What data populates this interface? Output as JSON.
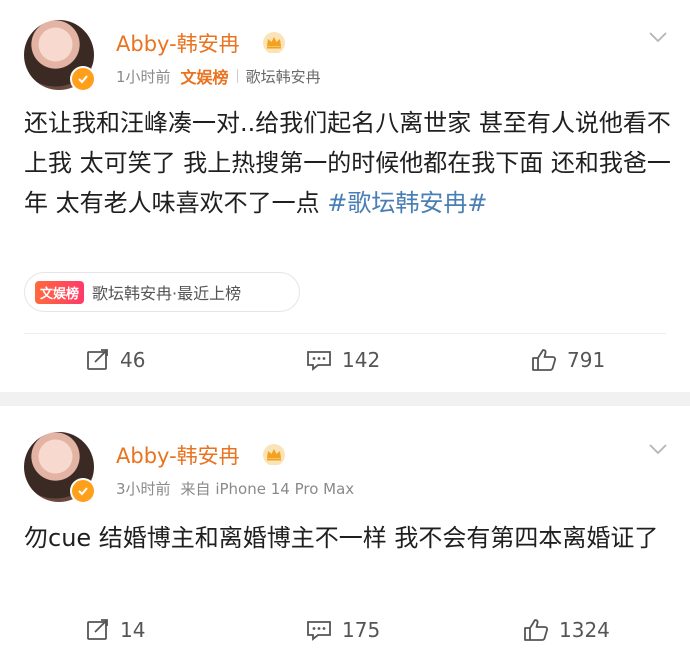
{
  "posts": [
    {
      "username": "Abby-韩安冉",
      "time": "1小时前",
      "tag_yule": "文娱榜",
      "tag_forum": "歌坛韩安冉",
      "text": "还让我和汪峰凑一对..给我们起名八离世家 甚至有人说他看不上我 太可笑了 我上热搜第一的时候他都在我下面 还和我爸一年 太有老人味喜欢不了一点 ",
      "hashtag": "#歌坛韩安冉#",
      "chip_badge": "文娱榜",
      "chip_text": "歌坛韩安冉·最近上榜",
      "reposts": "46",
      "comments": "142",
      "likes": "791"
    },
    {
      "username": "Abby-韩安冉",
      "time": "3小时前",
      "source": "来自 iPhone 14 Pro Max",
      "text": "勿cue 结婚博主和离婚博主不一样 我不会有第四本离婚证了",
      "reposts": "14",
      "comments": "175",
      "likes": "1324"
    }
  ],
  "colors": {
    "username": "#e9731f",
    "hashtag": "#4a7fb5",
    "meta": "#8a8a8a",
    "separator": "#f1f1f1"
  }
}
